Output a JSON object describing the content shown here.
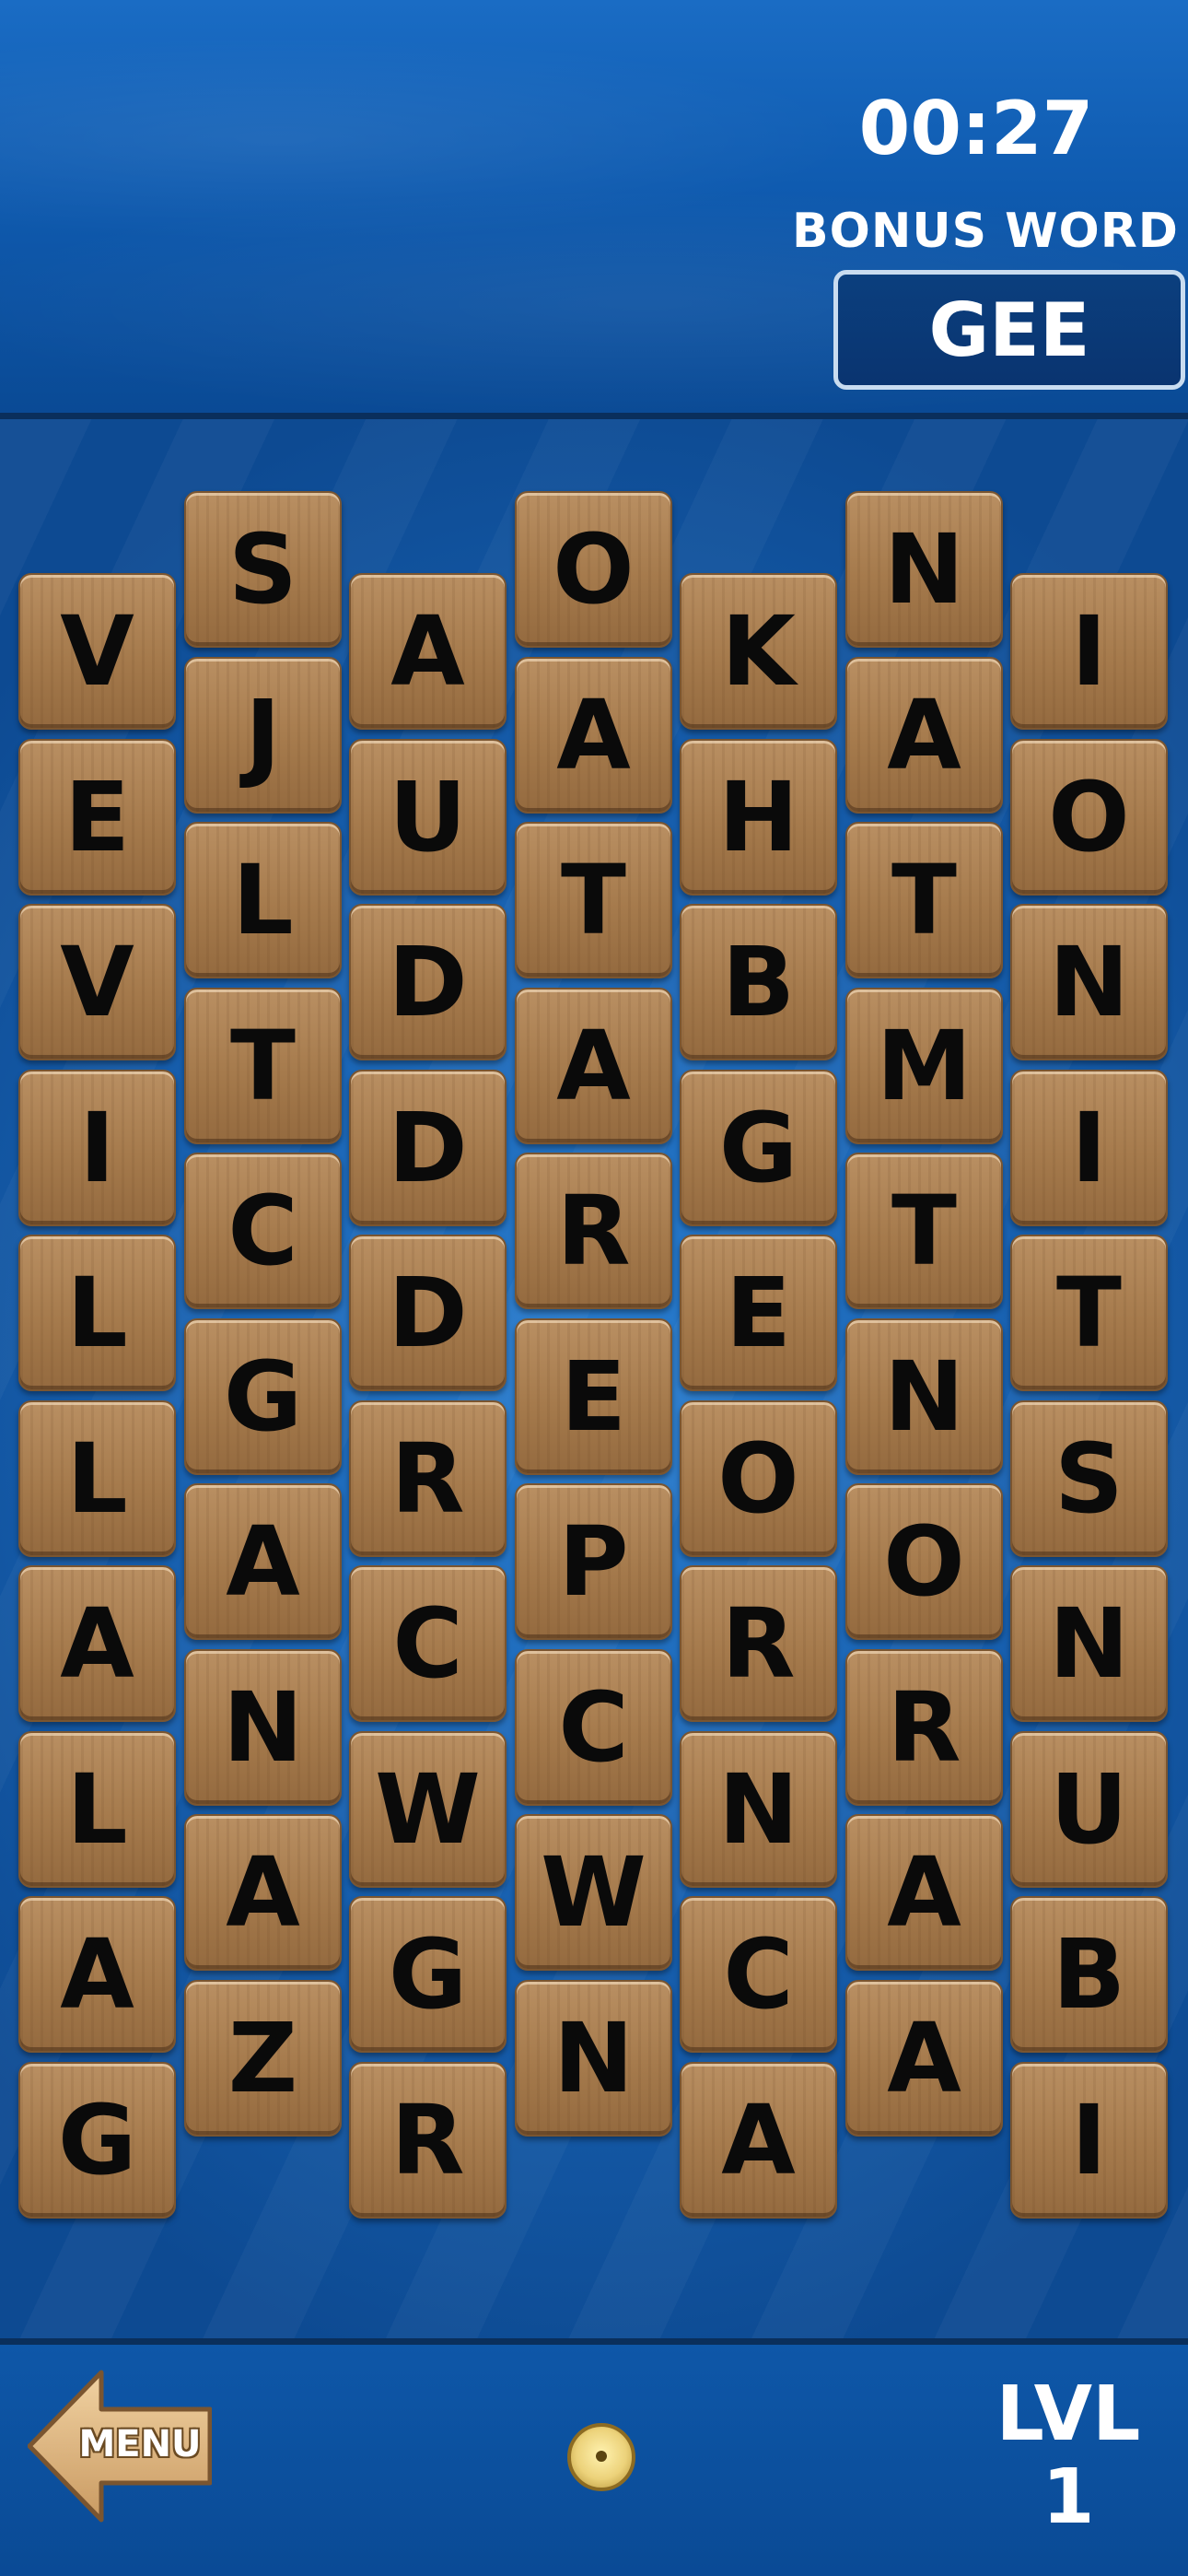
{
  "header": {
    "timer": "00:27",
    "bonus_label": "BONUS WORD",
    "bonus_word": "GEE"
  },
  "board": {
    "columns": [
      [
        "V",
        "E",
        "V",
        "I",
        "L",
        "L",
        "A",
        "L",
        "A",
        "G"
      ],
      [
        "S",
        "J",
        "L",
        "T",
        "C",
        "G",
        "A",
        "N",
        "A",
        "Z"
      ],
      [
        "A",
        "U",
        "D",
        "D",
        "D",
        "R",
        "C",
        "W",
        "G",
        "R"
      ],
      [
        "O",
        "A",
        "T",
        "A",
        "R",
        "E",
        "P",
        "C",
        "W",
        "N"
      ],
      [
        "K",
        "H",
        "B",
        "G",
        "E",
        "O",
        "R",
        "N",
        "C",
        "A"
      ],
      [
        "N",
        "A",
        "T",
        "M",
        "T",
        "N",
        "O",
        "R",
        "A",
        "A"
      ],
      [
        "I",
        "O",
        "N",
        "I",
        "T",
        "S",
        "N",
        "U",
        "B",
        "I"
      ]
    ]
  },
  "footer": {
    "menu_label": "MENU",
    "coin_icon": "coin-icon",
    "level_label": "LVL",
    "level_number": "1"
  },
  "colors": {
    "background": "#0d4f9a",
    "tile_wood": "#a57a4c",
    "text": "#ffffff"
  }
}
